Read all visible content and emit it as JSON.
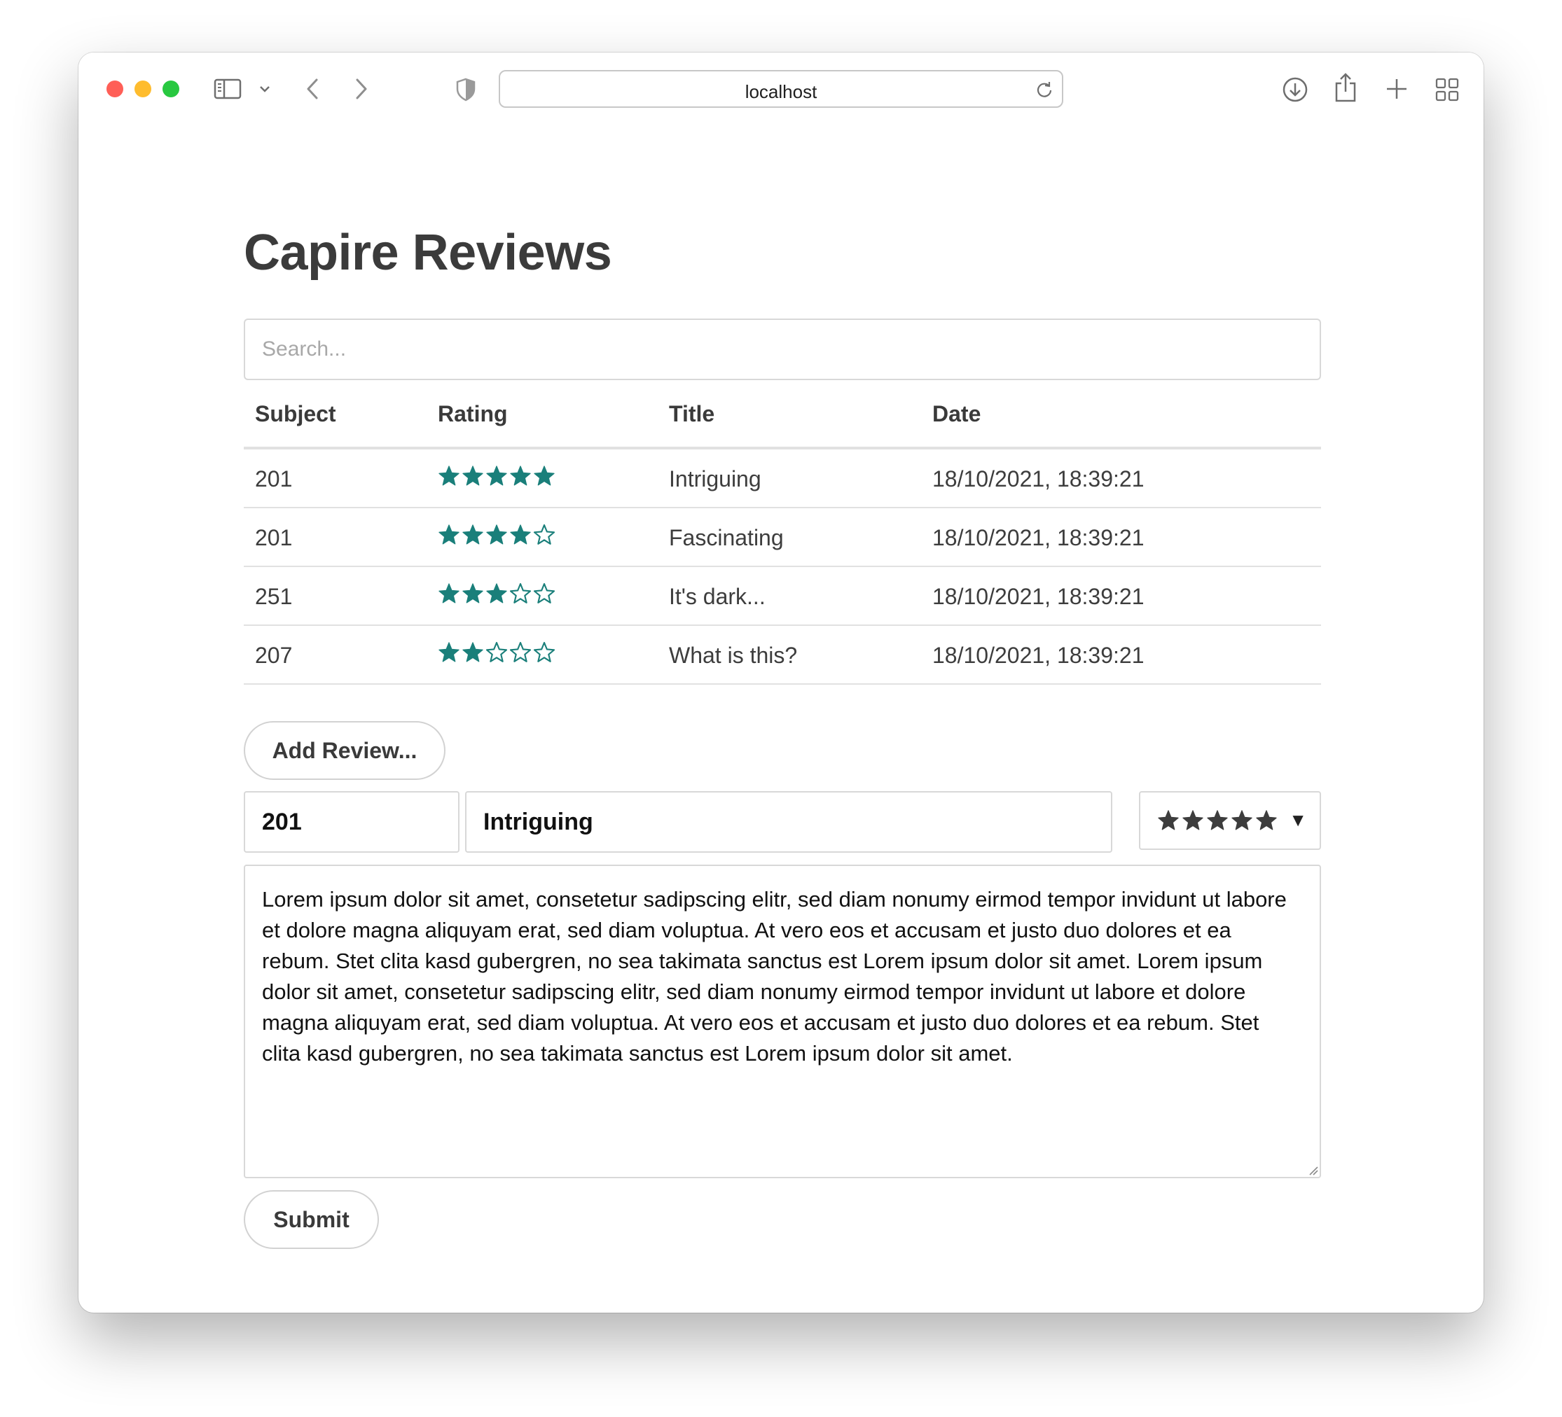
{
  "browser": {
    "url": "localhost",
    "icons": [
      "sidebar-icon",
      "chevron-down-icon",
      "back-icon",
      "forward-icon",
      "shield-icon",
      "reload-icon",
      "download-icon",
      "share-icon",
      "new-tab-icon",
      "tab-overview-icon"
    ]
  },
  "page": {
    "title": "Capire Reviews",
    "search": {
      "placeholder": "Search...",
      "value": ""
    },
    "table": {
      "columns": [
        "Subject",
        "Rating",
        "Title",
        "Date"
      ],
      "rows": [
        {
          "subject": "201",
          "rating": 5,
          "title": "Intriguing",
          "date": "18/10/2021, 18:39:21"
        },
        {
          "subject": "201",
          "rating": 4,
          "title": "Fascinating",
          "date": "18/10/2021, 18:39:21"
        },
        {
          "subject": "251",
          "rating": 3,
          "title": "It's dark...",
          "date": "18/10/2021, 18:39:21"
        },
        {
          "subject": "207",
          "rating": 2,
          "title": "What is this?",
          "date": "18/10/2021, 18:39:21"
        }
      ]
    },
    "add_review_label": "Add Review...",
    "form": {
      "subject": "201",
      "title": "Intriguing",
      "rating_selected": 5,
      "text": "Lorem ipsum dolor sit amet, consetetur sadipscing elitr, sed diam nonumy eirmod tempor invidunt ut labore et dolore magna aliquyam erat, sed diam voluptua. At vero eos et accusam et justo duo dolores et ea rebum. Stet clita kasd gubergren, no sea takimata sanctus est Lorem ipsum dolor sit amet. Lorem ipsum dolor sit amet, consetetur sadipscing elitr, sed diam nonumy eirmod tempor invidunt ut labore et dolore magna aliquyam erat, sed diam voluptua. At vero eos et accusam et justo duo dolores et ea rebum. Stet clita kasd gubergren, no sea takimata sanctus est Lorem ipsum dolor sit amet.",
      "submit_label": "Submit"
    }
  },
  "colors": {
    "star": "#1a7f7a",
    "select_star": "#3d3d3d",
    "title": "#3b3b3b"
  }
}
